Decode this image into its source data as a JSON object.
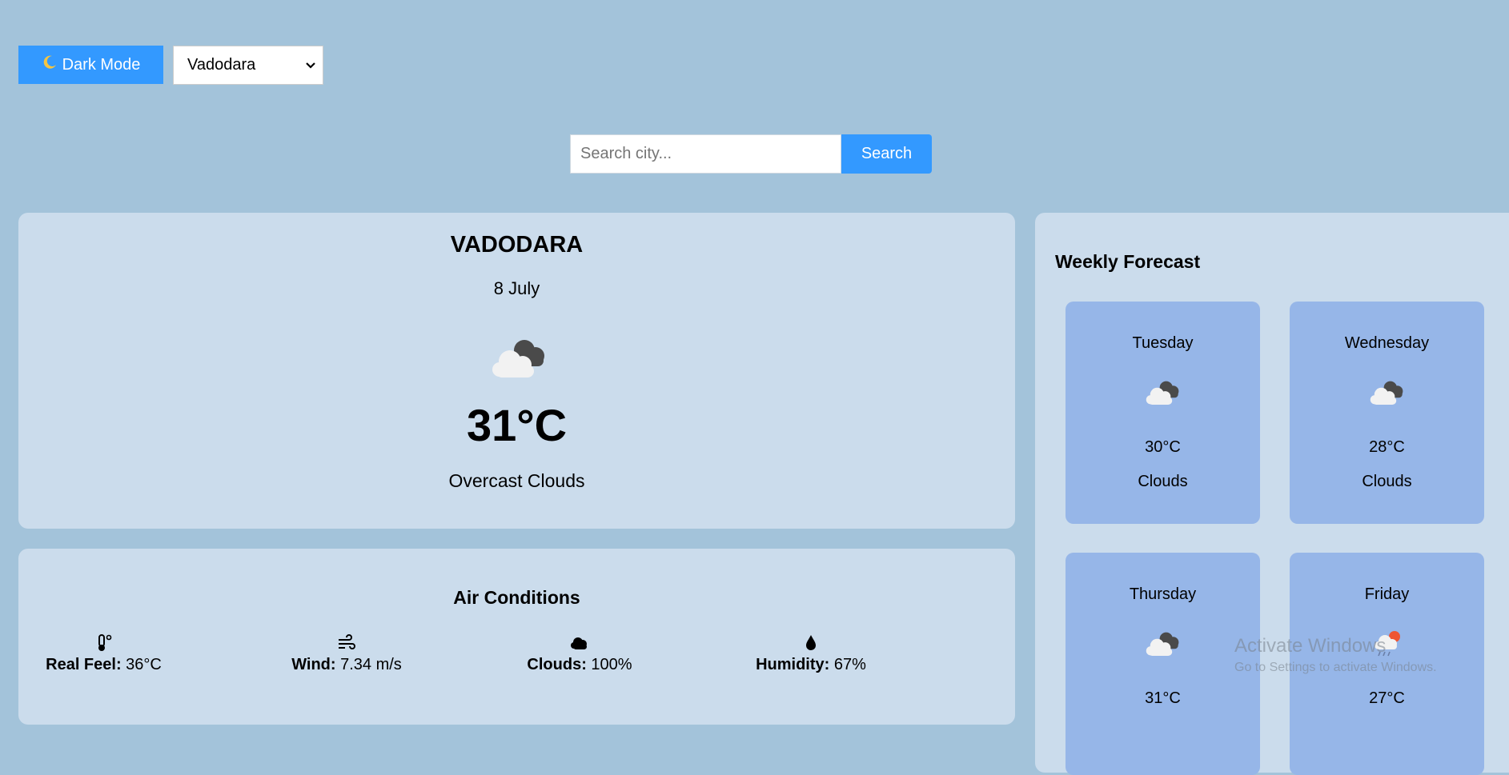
{
  "controls": {
    "dark_mode_label": "Dark Mode",
    "dark_mode_icon": "moon-icon",
    "selected_city": "Vadodara"
  },
  "search": {
    "placeholder": "Search city...",
    "button_label": "Search"
  },
  "current": {
    "city": "VADODARA",
    "date": "8 July",
    "icon": "overcast-cloud-icon",
    "temperature": "31°C",
    "description": "Overcast Clouds"
  },
  "air": {
    "title": "Air Conditions",
    "items": [
      {
        "icon": "thermometer-icon",
        "label": "Real Feel:",
        "value": "36°C"
      },
      {
        "icon": "wind-icon",
        "label": "Wind:",
        "value": "7.34 m/s"
      },
      {
        "icon": "cloud-icon",
        "label": "Clouds:",
        "value": "100%"
      },
      {
        "icon": "droplet-icon",
        "label": "Humidity:",
        "value": "67%"
      }
    ]
  },
  "forecast": {
    "title": "Weekly Forecast",
    "days": [
      {
        "day": "Tuesday",
        "icon": "overcast-cloud-icon",
        "temp": "30°C",
        "condition": "Clouds"
      },
      {
        "day": "Wednesday",
        "icon": "overcast-cloud-icon",
        "temp": "28°C",
        "condition": "Clouds"
      },
      {
        "day": "Thursday",
        "icon": "overcast-cloud-icon",
        "temp": "31°C",
        "condition": ""
      },
      {
        "day": "Friday",
        "icon": "rain-sun-icon",
        "temp": "27°C",
        "condition": ""
      }
    ]
  },
  "watermark": {
    "line1": "Activate Windows",
    "line2": "Go to Settings to activate Windows."
  }
}
